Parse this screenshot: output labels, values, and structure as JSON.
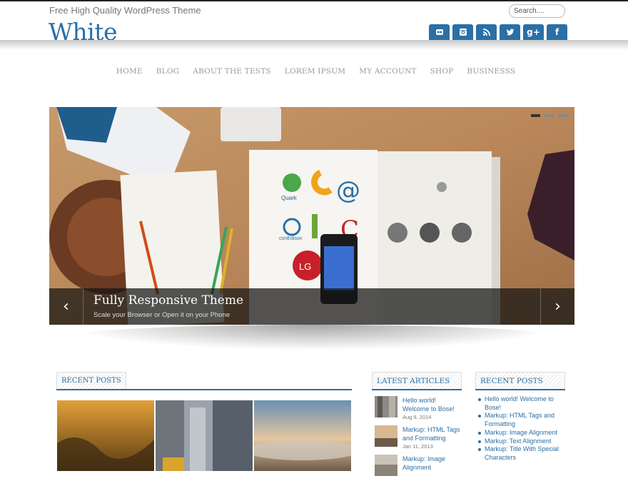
{
  "site": {
    "tagline": "Free High Quality WordPress Theme",
    "title": "White",
    "search_placeholder": "Search...."
  },
  "social": [
    {
      "icon": "flickr-icon",
      "glyph": "▪"
    },
    {
      "icon": "instagram-icon",
      "glyph": ""
    },
    {
      "icon": "rss-icon",
      "glyph": ""
    },
    {
      "icon": "twitter-icon",
      "glyph": ""
    },
    {
      "icon": "google-plus-icon",
      "glyph": "g+"
    },
    {
      "icon": "facebook-icon",
      "glyph": "f"
    }
  ],
  "nav": {
    "items": [
      "HOME",
      "BLOG",
      "ABOUT THE TESTS",
      "LOREM IPSUM",
      "MY ACCOUNT",
      "SHOP",
      "BUSINESSS"
    ]
  },
  "slider": {
    "title": "Fully Responsive Theme",
    "subtitle": "Scale your Browser or Open it on your Phone",
    "prev": "‹",
    "next": "›",
    "slides_count": 3,
    "active_slide": 1
  },
  "widgets": {
    "recent_posts_title": "RECENT POSTS",
    "latest_articles_title": "LATEST ARTICLES",
    "recent_posts_sidebar_title": "RECENT POSTS"
  },
  "latest_articles": [
    {
      "title": "Hello world! Welcome to Bose!",
      "date": "Aug 9, 2014"
    },
    {
      "title": "Markup: HTML Tags and Formatting",
      "date": "Jan 11, 2013"
    },
    {
      "title": "Markup: Image Alignment",
      "date": ""
    }
  ],
  "recent_posts": [
    "Hello world! Welcome to Bose!",
    "Markup: HTML Tags and Formatting",
    "Markup: Image Alignment",
    "Markup: Text Alignment",
    "Markup: Title With Special Characters"
  ],
  "colors": {
    "accent": "#2a6fa6",
    "nav_text": "#999999"
  }
}
